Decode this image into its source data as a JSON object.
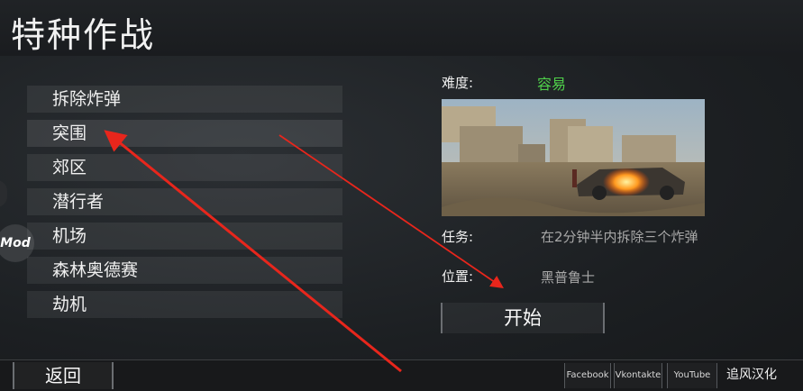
{
  "title": "特种作战",
  "menu_items": [
    {
      "label": "拆除炸弹"
    },
    {
      "label": "突围"
    },
    {
      "label": "郊区"
    },
    {
      "label": "潜行者"
    },
    {
      "label": "机场"
    },
    {
      "label": "森林奥德赛"
    },
    {
      "label": "劫机"
    }
  ],
  "side_badge": "Mod",
  "info": {
    "difficulty_label": "难度:",
    "difficulty_value": "容易",
    "task_label": "任务:",
    "task_value": "在2分钟半内拆除三个炸弹",
    "location_label": "位置:",
    "location_value": "黑普鲁士"
  },
  "start_label": "开始",
  "back_label": "返回",
  "social": {
    "facebook": "Facebook",
    "vkontakte": "Vkontakte",
    "youtube": "YouTube"
  },
  "credit": "追风汉化",
  "colors": {
    "difficulty": "#4fd04a",
    "arrow": "#e8261c"
  }
}
